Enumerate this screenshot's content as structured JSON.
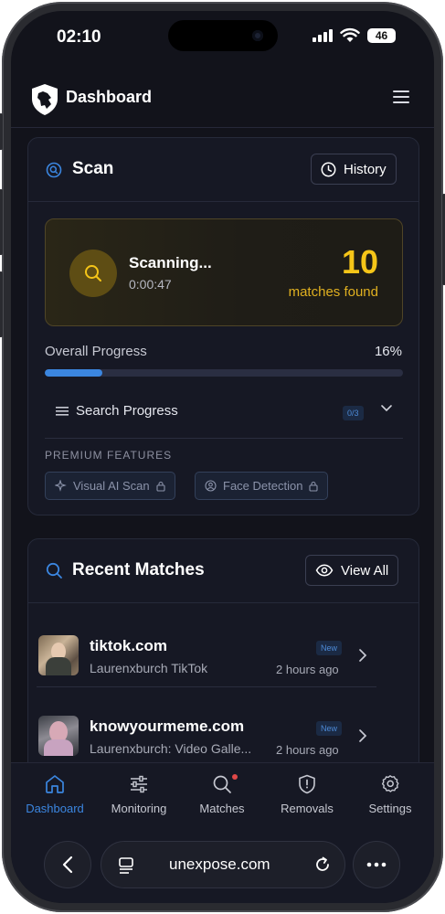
{
  "status_bar": {
    "time": "02:10",
    "battery": "46"
  },
  "header": {
    "title": "Dashboard"
  },
  "scan": {
    "title": "Scan",
    "history_label": "History",
    "status": "Scanning...",
    "elapsed": "0:00:47",
    "matches_count": "10",
    "matches_label": "matches found",
    "progress_label": "Overall Progress",
    "progress_percent": "16%",
    "progress_value": 0.16,
    "search_progress_label": "Search Progress",
    "search_progress_badge": "0/3",
    "premium_label": "PREMIUM FEATURES",
    "premium_features": [
      "Visual AI Scan",
      "Face Detection"
    ]
  },
  "recent_matches": {
    "title": "Recent Matches",
    "view_all_label": "View All",
    "items": [
      {
        "site": "tiktok.com",
        "description": "Laurenxburch TikTok",
        "badge": "New",
        "time": "2 hours ago"
      },
      {
        "site": "knowyourmeme.com",
        "description": "Laurenxburch: Video Galle...",
        "badge": "New",
        "time": "2 hours ago"
      }
    ]
  },
  "tabs": [
    {
      "label": "Dashboard",
      "icon": "home-icon",
      "active": true
    },
    {
      "label": "Monitoring",
      "icon": "sliders-icon",
      "active": false
    },
    {
      "label": "Matches",
      "icon": "search-icon",
      "active": false
    },
    {
      "label": "Removals",
      "icon": "shield-alert-icon",
      "active": false
    },
    {
      "label": "Settings",
      "icon": "gear-icon",
      "active": false
    }
  ],
  "browser": {
    "url": "unexpose.com"
  },
  "colors": {
    "accent": "#3b86e0",
    "gold": "#f5c518",
    "background": "#12131b"
  }
}
